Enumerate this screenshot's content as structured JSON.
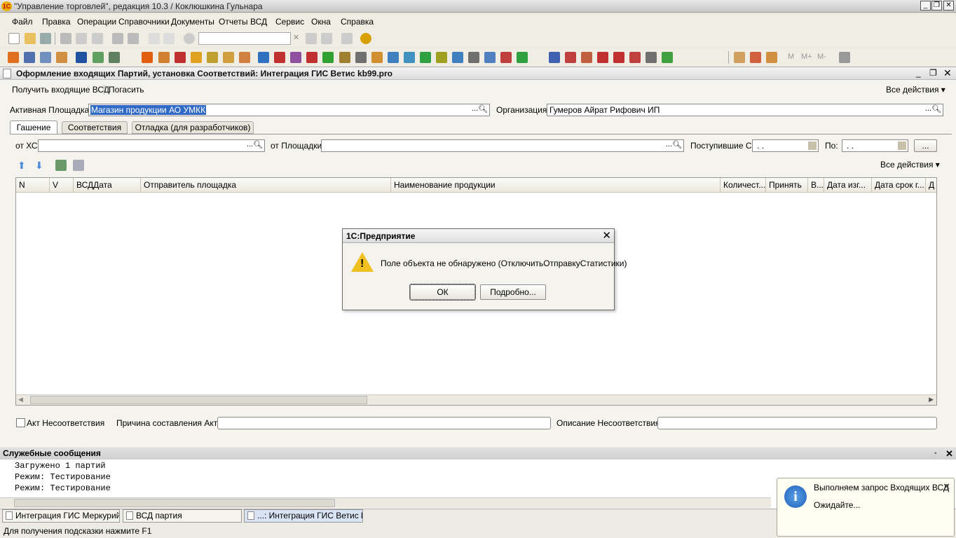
{
  "window": {
    "title": "\"Управление торговлей\", редакция 10.3 / Коклюшкина Гульнара",
    "logo": "1С"
  },
  "menu": [
    "Файл",
    "Правка",
    "Операции",
    "Справочники",
    "Документы",
    "Отчеты",
    "ВСД",
    "Сервис",
    "Окна",
    "Справка"
  ],
  "toolbar_m": [
    "M",
    "M+",
    "M-"
  ],
  "document": {
    "title": "Оформление входящих Партий, установка Соответствий: Интеграция ГИС Ветис kb99.pro",
    "actions": {
      "get_label": "Получить входящие ВСД",
      "pay_label": "Погасить",
      "all_actions": "Все действия"
    },
    "area_label": "Активная Площадка:",
    "area_value": "Магазин продукции АО УМКК",
    "org_label": "Организация:",
    "org_value": "Гумеров Айрат Рифович ИП",
    "tabs": [
      "Гашение",
      "Соответствия",
      "Отладка (для разработчиков)"
    ],
    "filter": {
      "hs_label": "от ХС:",
      "area_label": "от Площадки:",
      "from_label": "Поступившие С:",
      "from_value": " .  .",
      "to_label": "По:",
      "to_value": " .  .",
      "ellipsis": "..."
    },
    "grid_all_actions": "Все действия",
    "columns": [
      "N",
      "V",
      "ВСДДата",
      "Отправитель площадка",
      "Наименование продукции",
      "Количест...",
      "Принять",
      "В...",
      "Дата изг...",
      "Дата срок г...",
      "Д"
    ],
    "act_label": "Акт Несоответствия",
    "reason_label": "Причина составления Акта:",
    "desc_label": "Описание Несоответствия:"
  },
  "messages": {
    "title": "Служебные сообщения",
    "lines": [
      "Загружено 1 партий",
      "Режим: Тестирование",
      "Режим: Тестирование"
    ]
  },
  "taskbar": [
    "Интеграция ГИС Меркурий ...",
    "ВСД партия",
    "...: Интеграция ГИС Ветис k..."
  ],
  "status": "Для получения подсказки нажмите F1",
  "dialog": {
    "title": "1С:Предприятие",
    "message": "Поле объекта не обнаружено (ОтключитьОтправкуСтатистики)",
    "ok": "ОК",
    "details": "Подробно..."
  },
  "notification": {
    "title": "Выполняем запрос Входящих ВСД",
    "text": "Ожидайте..."
  }
}
